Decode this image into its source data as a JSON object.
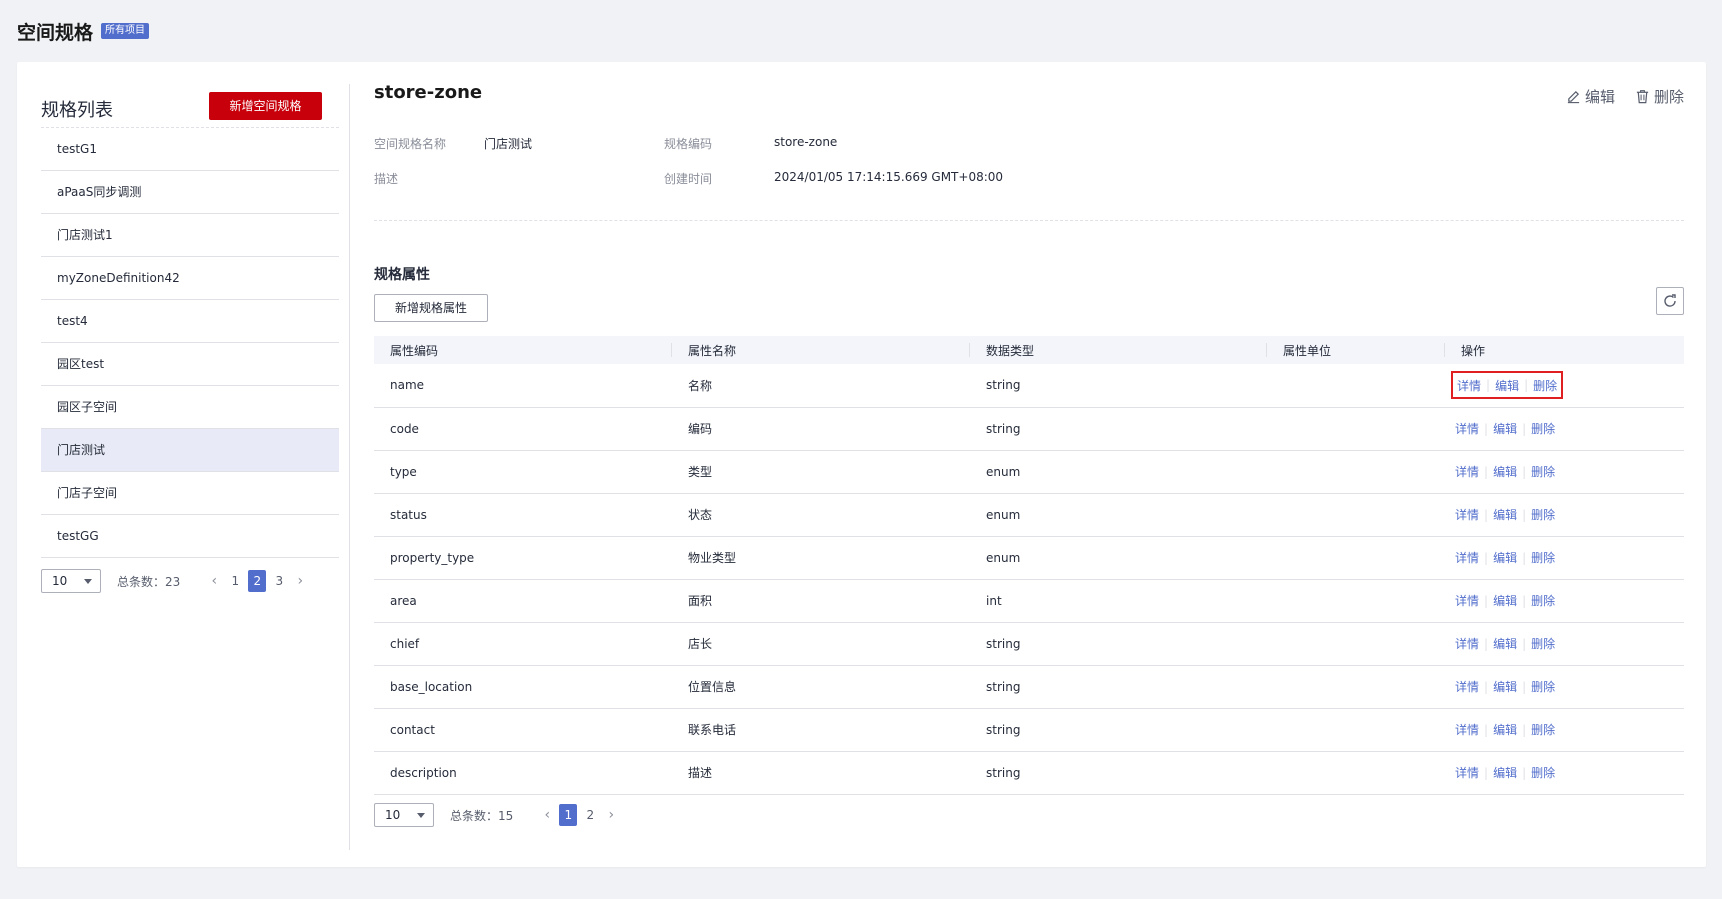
{
  "header": {
    "title": "空间规格",
    "badge": "所有项目"
  },
  "left": {
    "title": "规格列表",
    "add_button": "新增空间规格",
    "items": [
      "testG1",
      "aPaaS同步调测",
      "门店测试1",
      "myZoneDefinition42",
      "test4",
      "园区test",
      "园区子空间",
      "门店测试",
      "门店子空间",
      "testGG"
    ],
    "active_index": 7,
    "pager": {
      "page_size": "10",
      "total_label": "总条数：",
      "total": "23",
      "pages": [
        "1",
        "2",
        "3"
      ],
      "current": "2"
    }
  },
  "detail": {
    "title": "store-zone",
    "edit_label": "编辑",
    "delete_label": "删除",
    "fields": {
      "name_label": "空间规格名称",
      "name_value": "门店测试",
      "code_label": "规格编码",
      "code_value": "store-zone",
      "desc_label": "描述",
      "desc_value": "",
      "created_label": "创建时间",
      "created_value": "2024/01/05 17:14:15.669 GMT+08:00"
    }
  },
  "attrs": {
    "section_title": "规格属性",
    "add_button": "新增规格属性",
    "columns": [
      "属性编码",
      "属性名称",
      "数据类型",
      "属性单位",
      "操作"
    ],
    "ops": {
      "detail": "详情",
      "edit": "编辑",
      "delete": "删除"
    },
    "rows": [
      {
        "code": "name",
        "name": "名称",
        "type": "string",
        "unit": ""
      },
      {
        "code": "code",
        "name": "编码",
        "type": "string",
        "unit": ""
      },
      {
        "code": "type",
        "name": "类型",
        "type": "enum",
        "unit": ""
      },
      {
        "code": "status",
        "name": "状态",
        "type": "enum",
        "unit": ""
      },
      {
        "code": "property_type",
        "name": "物业类型",
        "type": "enum",
        "unit": ""
      },
      {
        "code": "area",
        "name": "面积",
        "type": "int",
        "unit": ""
      },
      {
        "code": "chief",
        "name": "店长",
        "type": "string",
        "unit": ""
      },
      {
        "code": "base_location",
        "name": "位置信息",
        "type": "string",
        "unit": ""
      },
      {
        "code": "contact",
        "name": "联系电话",
        "type": "string",
        "unit": ""
      },
      {
        "code": "description",
        "name": "描述",
        "type": "string",
        "unit": ""
      }
    ],
    "highlighted_row": 0,
    "pager": {
      "page_size": "10",
      "total_label": "总条数：",
      "total": "15",
      "pages": [
        "1",
        "2"
      ],
      "current": "1"
    }
  },
  "colors": {
    "primary": "#526ecc",
    "danger": "#c7000b",
    "highlight_border": "#e02020"
  }
}
